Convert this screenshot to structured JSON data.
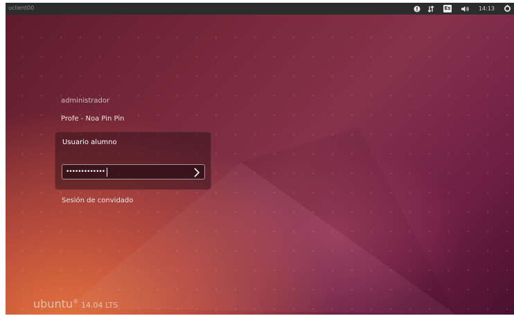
{
  "panel": {
    "hostname": "uclient00",
    "clock": "14:13"
  },
  "indicators": [
    {
      "name": "network-icon"
    },
    {
      "name": "transfer-icon"
    },
    {
      "name": "keyboard-layout-icon",
      "label": "Es"
    },
    {
      "name": "volume-icon"
    },
    {
      "name": "power-icon"
    }
  ],
  "users": {
    "first": "administrador",
    "second": "Profe - Noa Pin Pin",
    "selected": "Usuario alumno",
    "guest": "Sesión de convidado"
  },
  "password": {
    "masked_value": "•••••••••••••",
    "submit_icon": "chevron-right-icon"
  },
  "branding": {
    "name": "ubuntu",
    "registered": "®",
    "version": "14.04 LTS"
  },
  "colors": {
    "panel": "#2c2c2c",
    "accent": "#dd4814"
  }
}
